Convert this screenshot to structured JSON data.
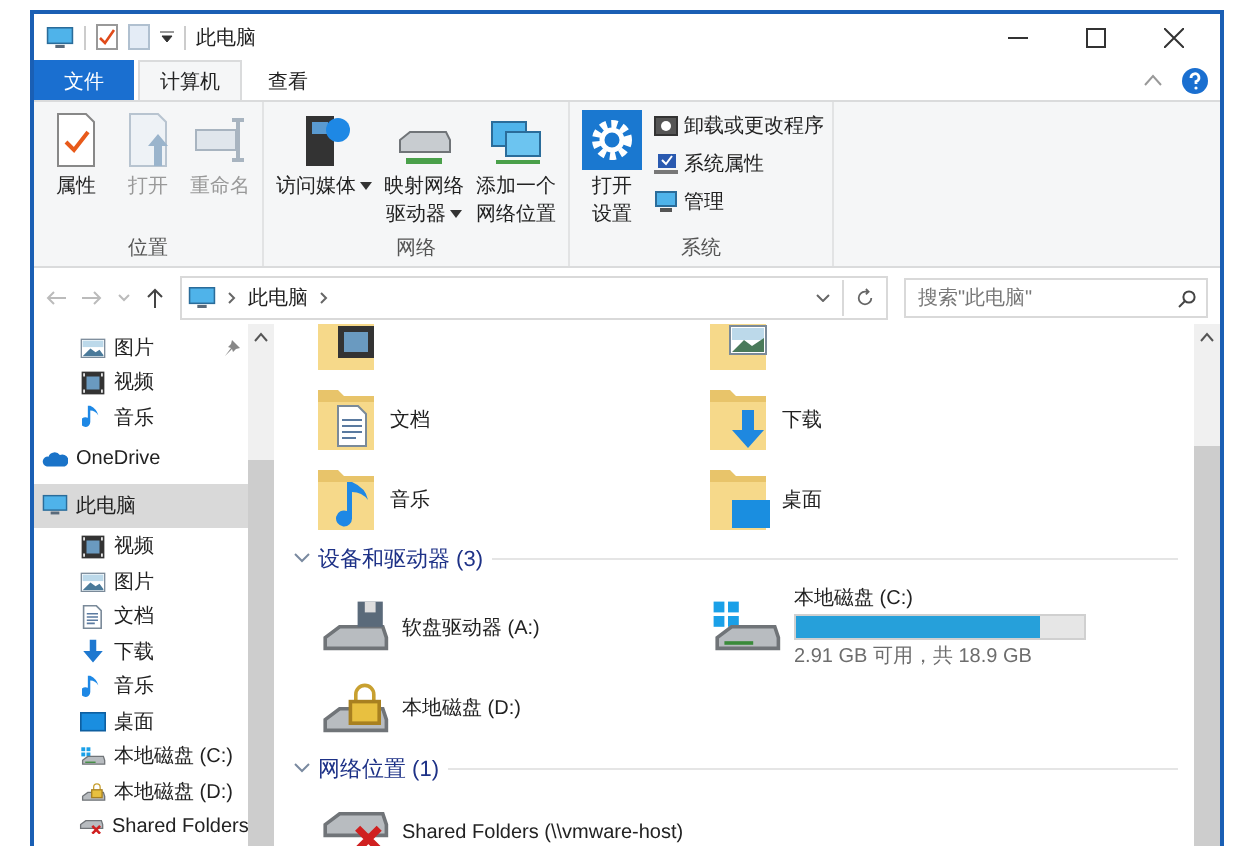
{
  "window": {
    "title": "此电脑"
  },
  "tabs": [
    {
      "label": "文件",
      "kind": "file",
      "selected": false
    },
    {
      "label": "计算机",
      "kind": "tab",
      "selected": true
    },
    {
      "label": "查看",
      "kind": "tab",
      "selected": false
    }
  ],
  "ribbon": {
    "groups": [
      {
        "label": "位置",
        "commands": [
          {
            "label": "属性",
            "kind": "properties",
            "disabled": false,
            "dropdown": false
          },
          {
            "label": "打开",
            "kind": "open",
            "disabled": true,
            "dropdown": false
          },
          {
            "label": "重命名",
            "kind": "rename",
            "disabled": true,
            "dropdown": false
          }
        ]
      },
      {
        "label": "网络",
        "commands": [
          {
            "label": "访问媒体",
            "kind": "media",
            "disabled": false,
            "dropdown": true
          },
          {
            "label": "映射网络",
            "label_line_2": "驱动器",
            "kind": "map-drive",
            "disabled": false,
            "dropdown": true
          },
          {
            "label": "添加一个",
            "label_line_2": "网络位置",
            "kind": "net-location",
            "disabled": false,
            "dropdown": false
          }
        ]
      },
      {
        "label": "系统",
        "commands": [
          {
            "label": "打开",
            "label_line_2": "设置",
            "kind": "settings",
            "disabled": false,
            "dropdown": false
          }
        ],
        "small_commands": [
          {
            "label": "卸载或更改程序",
            "kind": "uninstall"
          },
          {
            "label": "系统属性",
            "kind": "sysprops"
          },
          {
            "label": "管理",
            "kind": "manage"
          }
        ]
      }
    ]
  },
  "address_bar": {
    "path": [
      "此电脑"
    ],
    "search": {
      "placeholder": "搜索\"此电脑\""
    }
  },
  "sidebar": {
    "quick_access_items": [
      {
        "label": "图片",
        "kind": "pictures",
        "pinned": true,
        "selected": false
      },
      {
        "label": "视频",
        "kind": "video",
        "pinned": false,
        "selected": false
      },
      {
        "label": "音乐",
        "kind": "music",
        "pinned": false,
        "selected": false
      }
    ],
    "items": [
      {
        "label": "OneDrive",
        "kind": "cloud",
        "selected": false
      },
      {
        "label": "此电脑",
        "kind": "pc",
        "selected": true,
        "children": [
          {
            "label": "视频",
            "kind": "video",
            "selected": false
          },
          {
            "label": "图片",
            "kind": "pictures",
            "selected": false
          },
          {
            "label": "文档",
            "kind": "docs",
            "selected": false
          },
          {
            "label": "下载",
            "kind": "download",
            "selected": false
          },
          {
            "label": "音乐",
            "kind": "music",
            "selected": false
          },
          {
            "label": "桌面",
            "kind": "desktop",
            "selected": false
          },
          {
            "label": "本地磁盘 (C:)",
            "kind": "drive-win",
            "selected": false
          },
          {
            "label": "本地磁盘 (D:)",
            "kind": "drive-lock",
            "selected": false
          },
          {
            "label": "Shared Folders",
            "kind": "net-drive",
            "selected": false
          }
        ]
      }
    ]
  },
  "folders": [
    {
      "kind": "video"
    },
    {
      "kind": "pictures"
    },
    {
      "label": "文档",
      "kind": "docs"
    },
    {
      "label": "下载",
      "kind": "download"
    },
    {
      "label": "音乐",
      "kind": "music"
    },
    {
      "label": "桌面",
      "kind": "desktop"
    }
  ],
  "sections": [
    {
      "title": "设备和驱动器 (3)",
      "expanded": true,
      "items": [
        {
          "label": "软盘驱动器 (A:)",
          "kind": "floppy"
        },
        {
          "label": "本地磁盘 (C:)",
          "kind": "drive-win",
          "level": 0.85,
          "reading": "2.91 GB 可用，共 18.9 GB"
        },
        {
          "label": "本地磁盘 (D:)",
          "kind": "drive-lock"
        }
      ]
    },
    {
      "title": "网络位置 (1)",
      "expanded": true,
      "items": [
        {
          "label": "Shared Folders (\\\\vmware-host)",
          "kind": "net-drive"
        }
      ]
    }
  ]
}
